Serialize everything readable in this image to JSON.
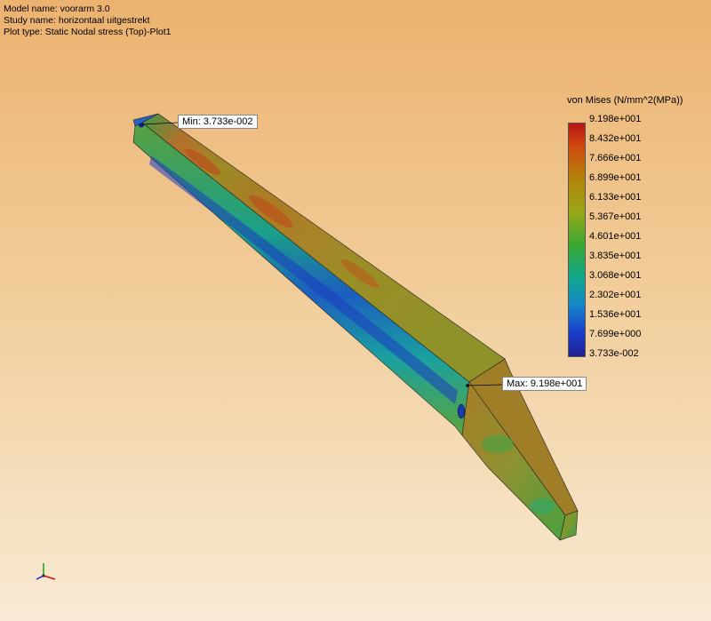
{
  "info": {
    "model_name": "Model name: voorarm 3.0",
    "study_name": "Study name: horizontaal uitgestrekt",
    "plot_type": "Plot type: Static Nodal stress (Top)-Plot1"
  },
  "legend": {
    "title": "von Mises (N/mm^2(MPa))",
    "ticks": [
      "9.198e+001",
      "8.432e+001",
      "7.666e+001",
      "6.899e+001",
      "6.133e+001",
      "5.367e+001",
      "4.601e+001",
      "3.835e+001",
      "3.068e+001",
      "2.302e+001",
      "1.536e+001",
      "7.699e+000",
      "3.733e-002"
    ]
  },
  "callouts": {
    "min": "Min: 3.733e-002",
    "max": "Max: 9.198e+001"
  },
  "colors": {
    "max_red": "#b81414",
    "mid_green": "#3aa832",
    "min_blue": "#202090",
    "background_top": "#ecb26f",
    "background_bottom": "#f8ead4"
  },
  "icons": {
    "triad": "xyz-axis-triad-icon"
  }
}
